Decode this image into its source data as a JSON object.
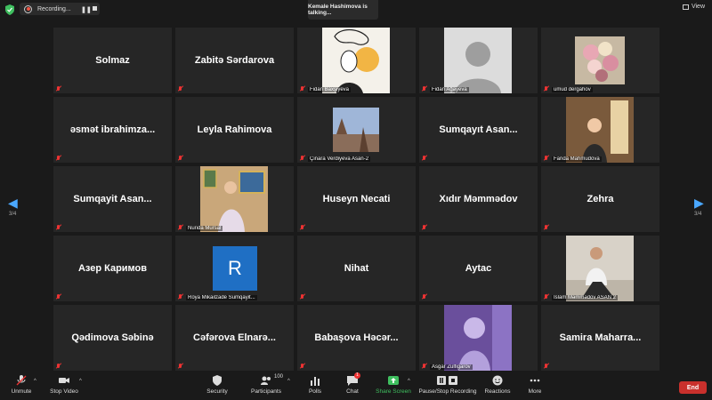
{
  "top": {
    "recording_label": "Recording...",
    "talking": "Kemale Hashimova is talking...",
    "view_label": "View"
  },
  "nav": {
    "left_page": "3/4",
    "right_page": "3/4"
  },
  "tiles": [
    {
      "name": "Solmaz"
    },
    {
      "name": "Zabitə Sərdarova"
    },
    {
      "caption": "Fidan Baxşiyeva"
    },
    {
      "caption": "Fidan Ağayeva"
    },
    {
      "caption": "umud dergahov"
    },
    {
      "name": "əsmət  ibrahimza..."
    },
    {
      "name": "Leyla Rahimova"
    },
    {
      "caption": "Çinara Verdiyeva Asan-2"
    },
    {
      "name": "Sumqayıt  Asan..."
    },
    {
      "caption": "Farida Mahmudova"
    },
    {
      "name": "Sumqayit  Asan..."
    },
    {
      "caption": "Nurida Mursal"
    },
    {
      "name": "Huseyn Necati"
    },
    {
      "name": "Xıdır Məmmədov"
    },
    {
      "name": "Zehra"
    },
    {
      "name": "Азер Каримов"
    },
    {
      "caption": "Roya Mikailzade Sumqayit...",
      "avatar_letter": "R"
    },
    {
      "name": "Nihat"
    },
    {
      "name": "Aytac"
    },
    {
      "caption": "İslam Məmmədov ASAN 2"
    },
    {
      "name": "Qədimova Səbinə"
    },
    {
      "name": "Cəfərova  Elnarə..."
    },
    {
      "name": "Babaşova  Həcər..."
    },
    {
      "caption": "Asgar Zulfigarov"
    },
    {
      "name": "Samira  Maharra..."
    }
  ],
  "toolbar": {
    "unmute": "Unmute",
    "stop_video": "Stop Video",
    "security": "Security",
    "participants": "Participants",
    "participants_count": "100",
    "polls": "Polls",
    "chat": "Chat",
    "chat_badge": "1",
    "share_screen": "Share Screen",
    "pause_recording": "Pause/Stop Recording",
    "reactions": "Reactions",
    "more": "More",
    "end": "End"
  },
  "colors": {
    "accent_blue": "#4aa8ff",
    "share_green": "#3fbf5f",
    "end_red": "#c9302c",
    "muted_red": "#e33333"
  }
}
